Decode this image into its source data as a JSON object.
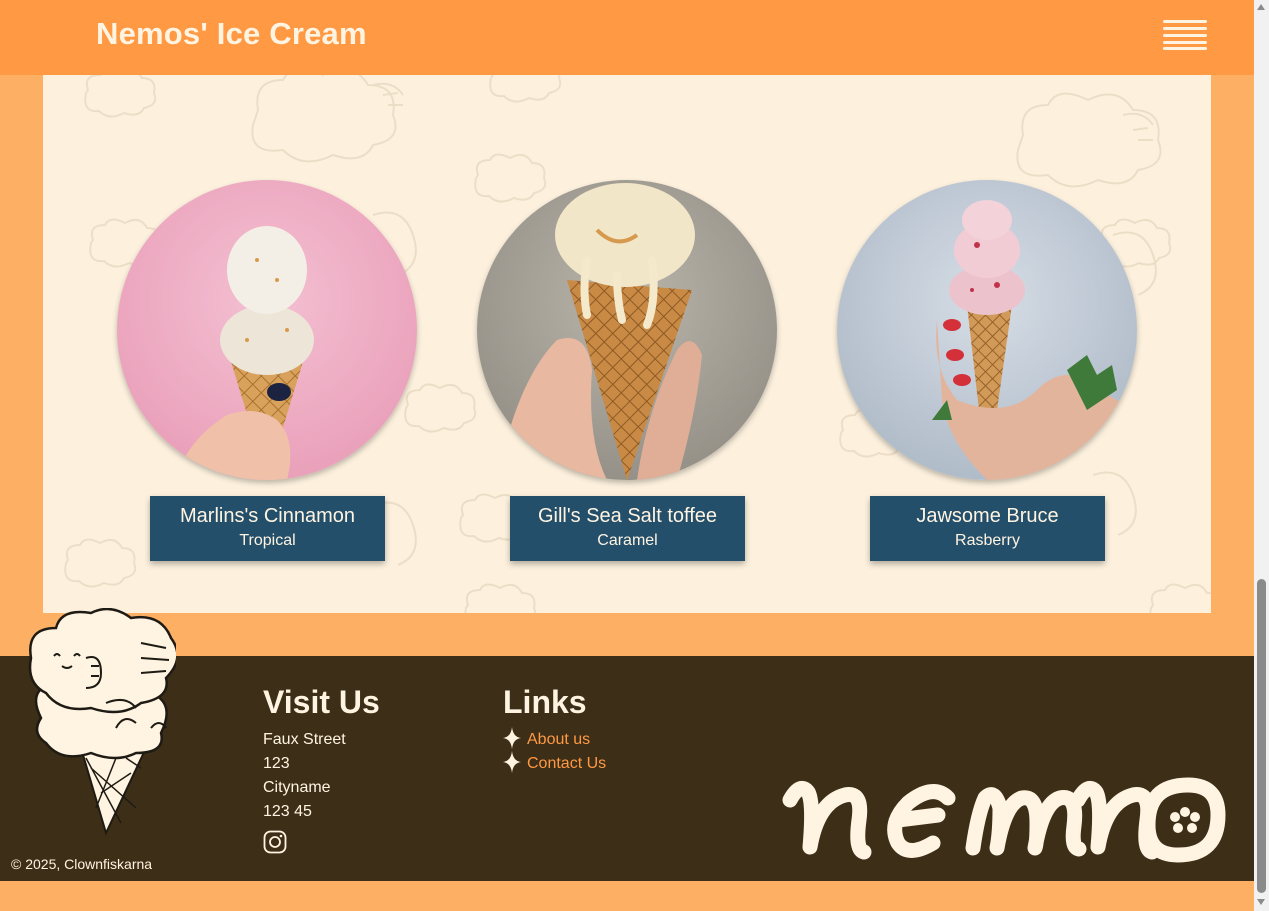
{
  "header": {
    "brand": "Nemos' Ice Cream",
    "menu_icon": "hamburger-menu-icon"
  },
  "products": [
    {
      "name": "Marlins's Cinnamon",
      "flavor": "Tropical",
      "image": "ice-cream-cone-pink-background"
    },
    {
      "name": "Gill's Sea Salt toffee",
      "flavor": "Caramel",
      "image": "ice-cream-cone-caramel-drip"
    },
    {
      "name": "Jawsome Bruce",
      "flavor": "Rasberry",
      "image": "ice-cream-cone-raspberry"
    }
  ],
  "footer": {
    "copyright": "© 2025, Clownfiskarna",
    "visit": {
      "title": "Visit Us",
      "lines": [
        "Faux Street",
        "123",
        "Cityname",
        "123 45"
      ],
      "social_icon": "instagram-icon"
    },
    "links": {
      "title": "Links",
      "items": [
        "About us",
        "Contact Us"
      ],
      "bullet_icon": "sparkle-star-icon"
    },
    "logo_text": "nemo"
  },
  "colors": {
    "header": "#ff9944",
    "page_bg": "#fdb064",
    "panel": "#fdf1de",
    "label_bg": "#234f6b",
    "footer_bg": "#3d2e17",
    "cream": "#fff4e2",
    "link": "#ff9944"
  }
}
